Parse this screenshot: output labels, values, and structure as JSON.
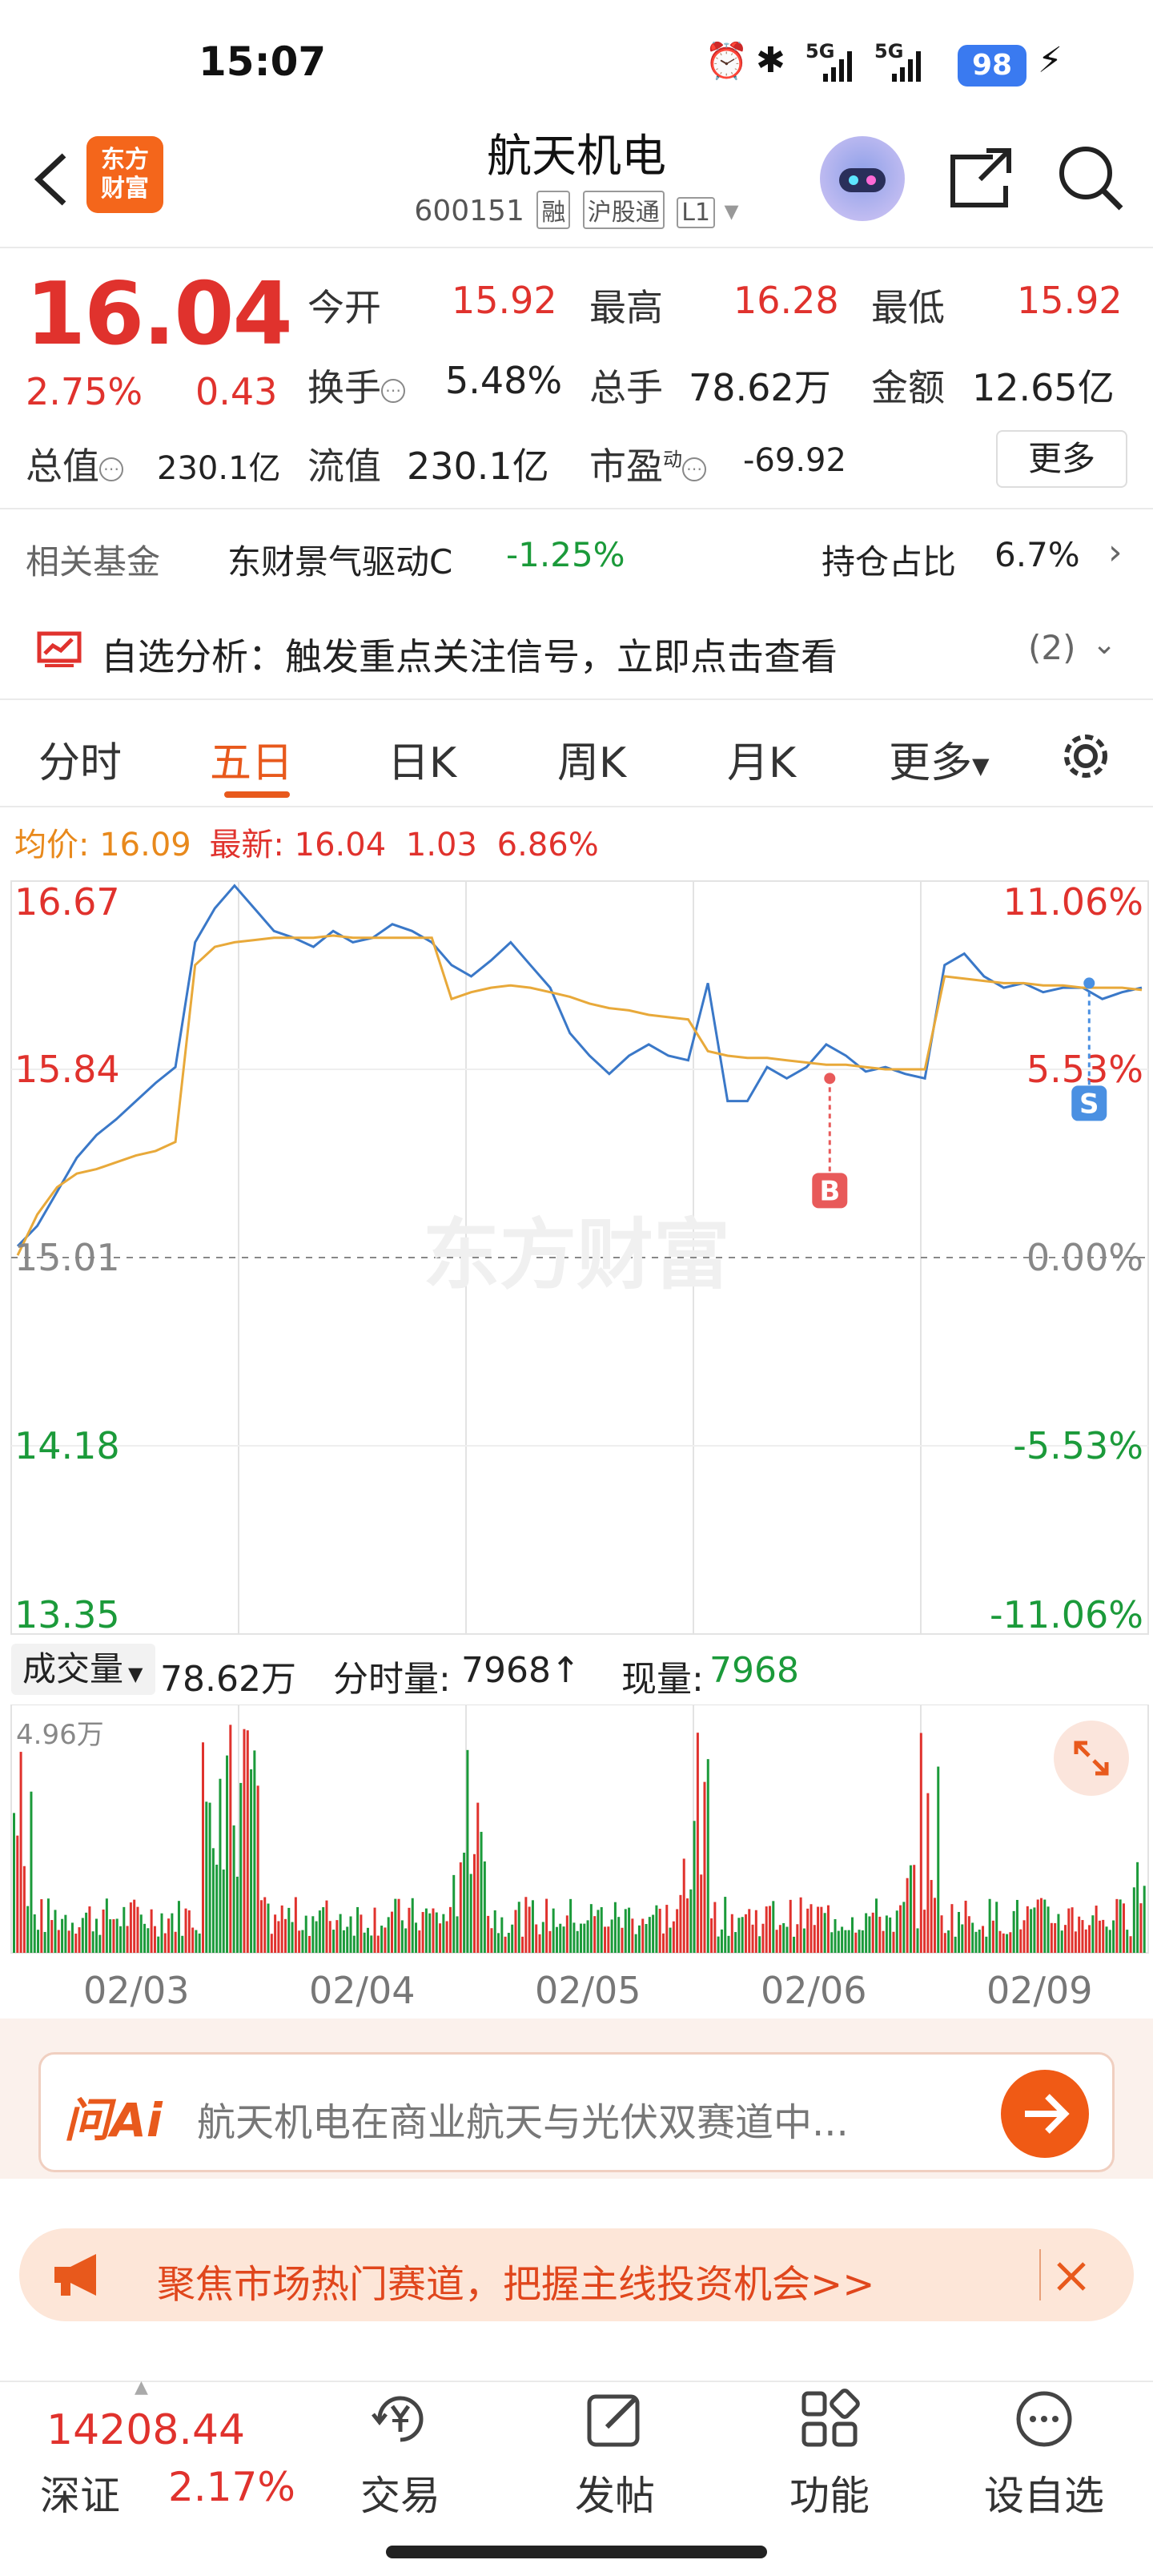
{
  "status_bar": {
    "time": "15:07",
    "battery": "98",
    "signal_1": "5G",
    "signal_2": "5G"
  },
  "header": {
    "name": "航天机电",
    "code": "600151",
    "tag_rong": "融",
    "tag_hgt": "沪股通",
    "tag_level": "L1",
    "logo_line1": "东方",
    "logo_line2": "财富"
  },
  "quote": {
    "price": "16.04",
    "change_pct": "2.75%",
    "change_amt": "0.43",
    "open_label": "今开",
    "open": "15.92",
    "high_label": "最高",
    "high": "16.28",
    "low_label": "最低",
    "low": "15.92",
    "turnover_label": "换手",
    "turnover": "5.48%",
    "volume_label": "总手",
    "volume": "78.62万",
    "amount_label": "金额",
    "amount": "12.65亿",
    "mktcap_label": "总值",
    "mktcap": "230.1亿",
    "float_label": "流值",
    "float": "230.1亿",
    "pe_label": "市盈",
    "pe_sup": "动",
    "pe": "-69.92",
    "more": "更多"
  },
  "fund": {
    "label": "相关基金",
    "name": "东财景气驱动C",
    "change": "-1.25%",
    "hold_label": "持仓占比",
    "hold": "6.7%"
  },
  "signal": {
    "text": "自选分析：触发重点关注信号，立即点击查看",
    "count": "(2)"
  },
  "tabs": [
    "分时",
    "五日",
    "日K",
    "周K",
    "月K",
    "更多"
  ],
  "info_line": {
    "avg_label": "均价:",
    "avg": "16.09",
    "latest_label": "最新:",
    "latest": "16.04",
    "chg": "1.03",
    "pct": "6.86%"
  },
  "chart_data": {
    "type": "line",
    "title": "",
    "x": [
      "02/03",
      "02/04",
      "02/05",
      "02/06",
      "02/09"
    ],
    "y_left_ticks": [
      "16.67",
      "15.84",
      "15.01",
      "14.18",
      "13.35"
    ],
    "y_right_ticks": [
      "11.06%",
      "5.53%",
      "0.00%",
      "-5.53%",
      "-11.06%"
    ],
    "ylim": [
      13.35,
      16.67
    ],
    "prev_close": 15.01,
    "series": [
      {
        "values": [
          15.06,
          15.15,
          15.3,
          15.45,
          15.55,
          15.62,
          15.7,
          15.78,
          15.85,
          16.4,
          16.55,
          16.65,
          16.55,
          16.45,
          16.42,
          16.38,
          16.45,
          16.4,
          16.42,
          16.48,
          16.45,
          16.4,
          16.3,
          16.25,
          16.32,
          16.4,
          16.3,
          16.2,
          16.0,
          15.9,
          15.82,
          15.9,
          15.95,
          15.9,
          15.88,
          16.22,
          15.7,
          15.7,
          15.85,
          15.8,
          15.85,
          15.95,
          15.9,
          15.83,
          15.85,
          15.82,
          15.8,
          16.3,
          16.35,
          16.25,
          16.2,
          16.22,
          16.18,
          16.2,
          16.2,
          16.15,
          16.18,
          16.2
        ]
      },
      {
        "values": [
          15.02,
          15.2,
          15.32,
          15.38,
          15.4,
          15.43,
          15.46,
          15.48,
          15.52,
          16.3,
          16.38,
          16.4,
          16.41,
          16.42,
          16.42,
          16.42,
          16.43,
          16.42,
          16.42,
          16.42,
          16.42,
          16.42,
          16.15,
          16.18,
          16.2,
          16.21,
          16.2,
          16.18,
          16.16,
          16.13,
          16.11,
          16.1,
          16.08,
          16.07,
          16.06,
          15.92,
          15.9,
          15.89,
          15.89,
          15.88,
          15.87,
          15.86,
          15.86,
          15.85,
          15.84,
          15.84,
          15.84,
          16.25,
          16.24,
          16.23,
          16.22,
          16.22,
          16.21,
          16.21,
          16.2,
          16.2,
          16.2,
          16.19
        ]
      }
    ],
    "markers": [
      {
        "label": "B",
        "day": "02/06",
        "price": 15.8
      },
      {
        "label": "S",
        "day": "02/09",
        "price": 16.22
      }
    ],
    "watermark": "东方财富"
  },
  "volume": {
    "selector": "成交量",
    "total": "78.62万",
    "tick_label": "分时量:",
    "tick": "7968↑",
    "now_label": "现量:",
    "now": "7968",
    "max": "4.96万",
    "colors": {
      "up": "#e0322d",
      "down": "#1b9a3a"
    }
  },
  "ai": {
    "logo": "问Ai",
    "text": "航天机电在商业航天与光伏双赛道中..."
  },
  "banner": {
    "text": "聚焦市场热门赛道，把握主线投资机会>>"
  },
  "bottom_nav": {
    "index_value": "14208.44",
    "index_name": "深证",
    "index_change": "2.17%",
    "items": [
      "交易",
      "发帖",
      "功能",
      "设自选"
    ]
  },
  "colors": {
    "up": "#e0322d",
    "down": "#1b9a3a",
    "accent": "#e8591c",
    "avg_line": "#e8a93a",
    "price_line": "#3a78c8"
  }
}
